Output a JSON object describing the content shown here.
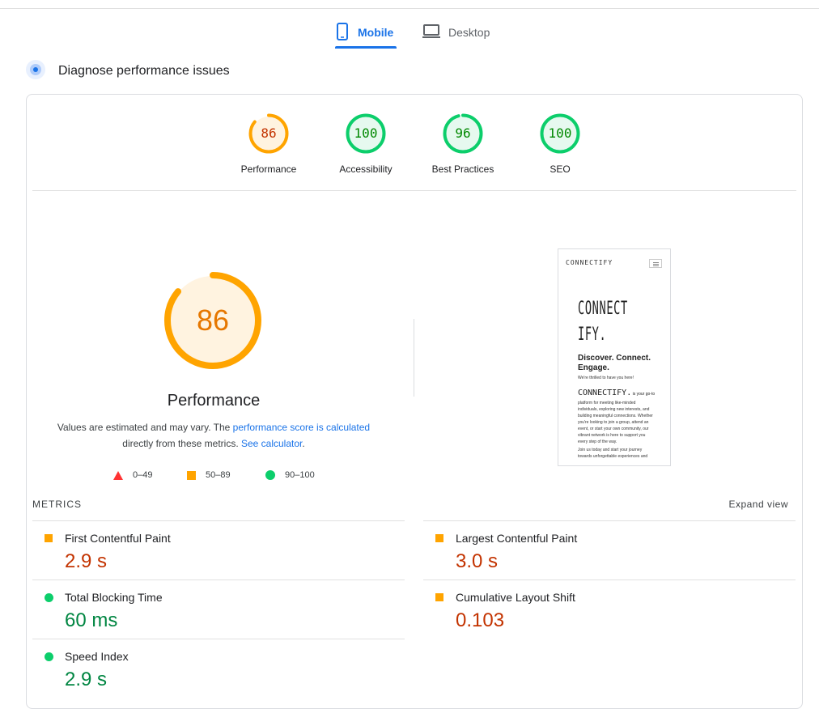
{
  "tabs": {
    "mobile_label": "Mobile",
    "desktop_label": "Desktop"
  },
  "diagnose": {
    "title": "Diagnose performance issues"
  },
  "summary": [
    {
      "label": "Performance",
      "score": "86",
      "score_value": 86,
      "color": "#ffa400",
      "text_color": "#c33300",
      "fill": "#fff3e0"
    },
    {
      "label": "Accessibility",
      "score": "100",
      "score_value": 100,
      "color": "#0cce6b",
      "text_color": "#008800",
      "fill": "#e6f9ef"
    },
    {
      "label": "Best Practices",
      "score": "96",
      "score_value": 96,
      "color": "#0cce6b",
      "text_color": "#008800",
      "fill": "#e6f9ef"
    },
    {
      "label": "SEO",
      "score": "100",
      "score_value": 100,
      "color": "#0cce6b",
      "text_color": "#008800",
      "fill": "#e6f9ef"
    }
  ],
  "performance": {
    "score": "86",
    "score_value": 86,
    "title": "Performance",
    "note_prefix": "Values are estimated and may vary. The ",
    "note_link": "performance score is calculated",
    "note_mid": "directly from these metrics. ",
    "note_link2": "See calculator",
    "note_suffix": "."
  },
  "legend": {
    "fail": "0–49",
    "average": "50–89",
    "pass": "90–100"
  },
  "screenshot": {
    "logo": "CONNECTIFY",
    "headline": "CONNECT\nIFY.",
    "subhead": "Discover. Connect. Engage.",
    "small": "We're thrilled to have you here!",
    "mid_brand": "CONNECTIFY.",
    "mid_rest": " is your go-to",
    "para": "platform for meeting like-minded individuals, exploring new interests, and building meaningful connections. Whether you're looking to join a group, attend an event, or start your own community, our vibrant network is here to support you every step of the way.",
    "para2": "Join us today and start your journey towards unforgettable experiences and"
  },
  "metrics": {
    "heading": "METRICS",
    "expand_label": "Expand view",
    "items": [
      {
        "name": "First Contentful Paint",
        "value": "2.9 s",
        "status": "average"
      },
      {
        "name": "Largest Contentful Paint",
        "value": "3.0 s",
        "status": "average"
      },
      {
        "name": "Total Blocking Time",
        "value": "60 ms",
        "status": "pass"
      },
      {
        "name": "Cumulative Layout Shift",
        "value": "0.103",
        "status": "average"
      },
      {
        "name": "Speed Index",
        "value": "2.9 s",
        "status": "pass"
      }
    ]
  },
  "icons": {
    "mobile": "phone-icon",
    "desktop": "laptop-icon",
    "diagnose": "lighthouse-icon"
  }
}
